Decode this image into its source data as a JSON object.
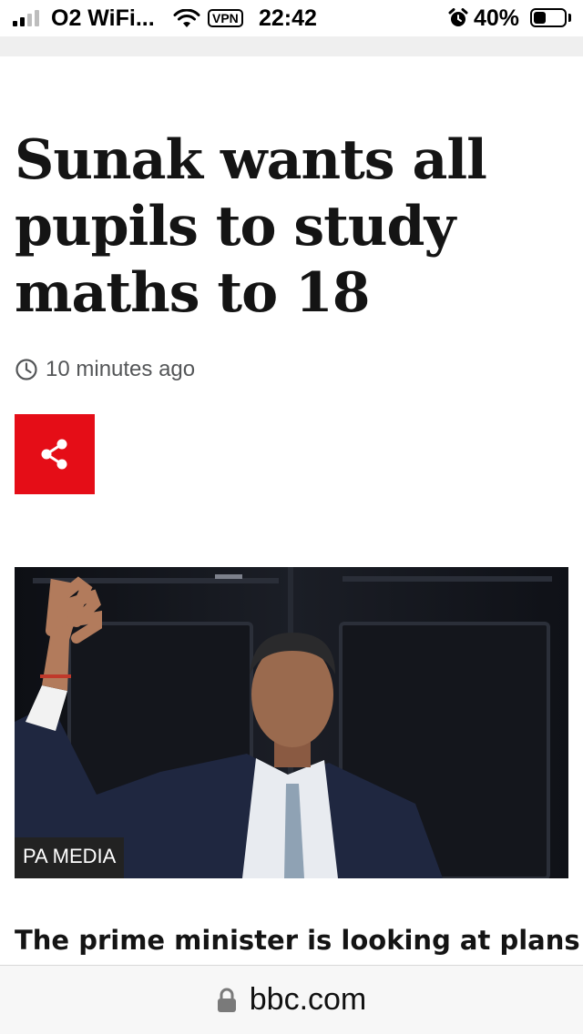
{
  "status_bar": {
    "carrier": "O2 WiFi...",
    "vpn": "VPN",
    "time": "22:42",
    "battery_percent": "40%",
    "battery_level": 0.4,
    "icons": [
      "signal-icon",
      "wifi-icon",
      "alarm-icon",
      "battery-icon"
    ]
  },
  "article": {
    "headline": "Sunak wants all pupils to study maths to 18",
    "timestamp": "10 minutes ago",
    "share_icon": "share-icon",
    "image": {
      "credit": "PA MEDIA"
    },
    "lead": "The prime minister is looking at plans to"
  },
  "browser": {
    "url": "bbc.com",
    "lock_icon": "lock-icon"
  },
  "colors": {
    "share_red": "#e50d17",
    "text": "#141414",
    "meta_text": "#545658"
  }
}
